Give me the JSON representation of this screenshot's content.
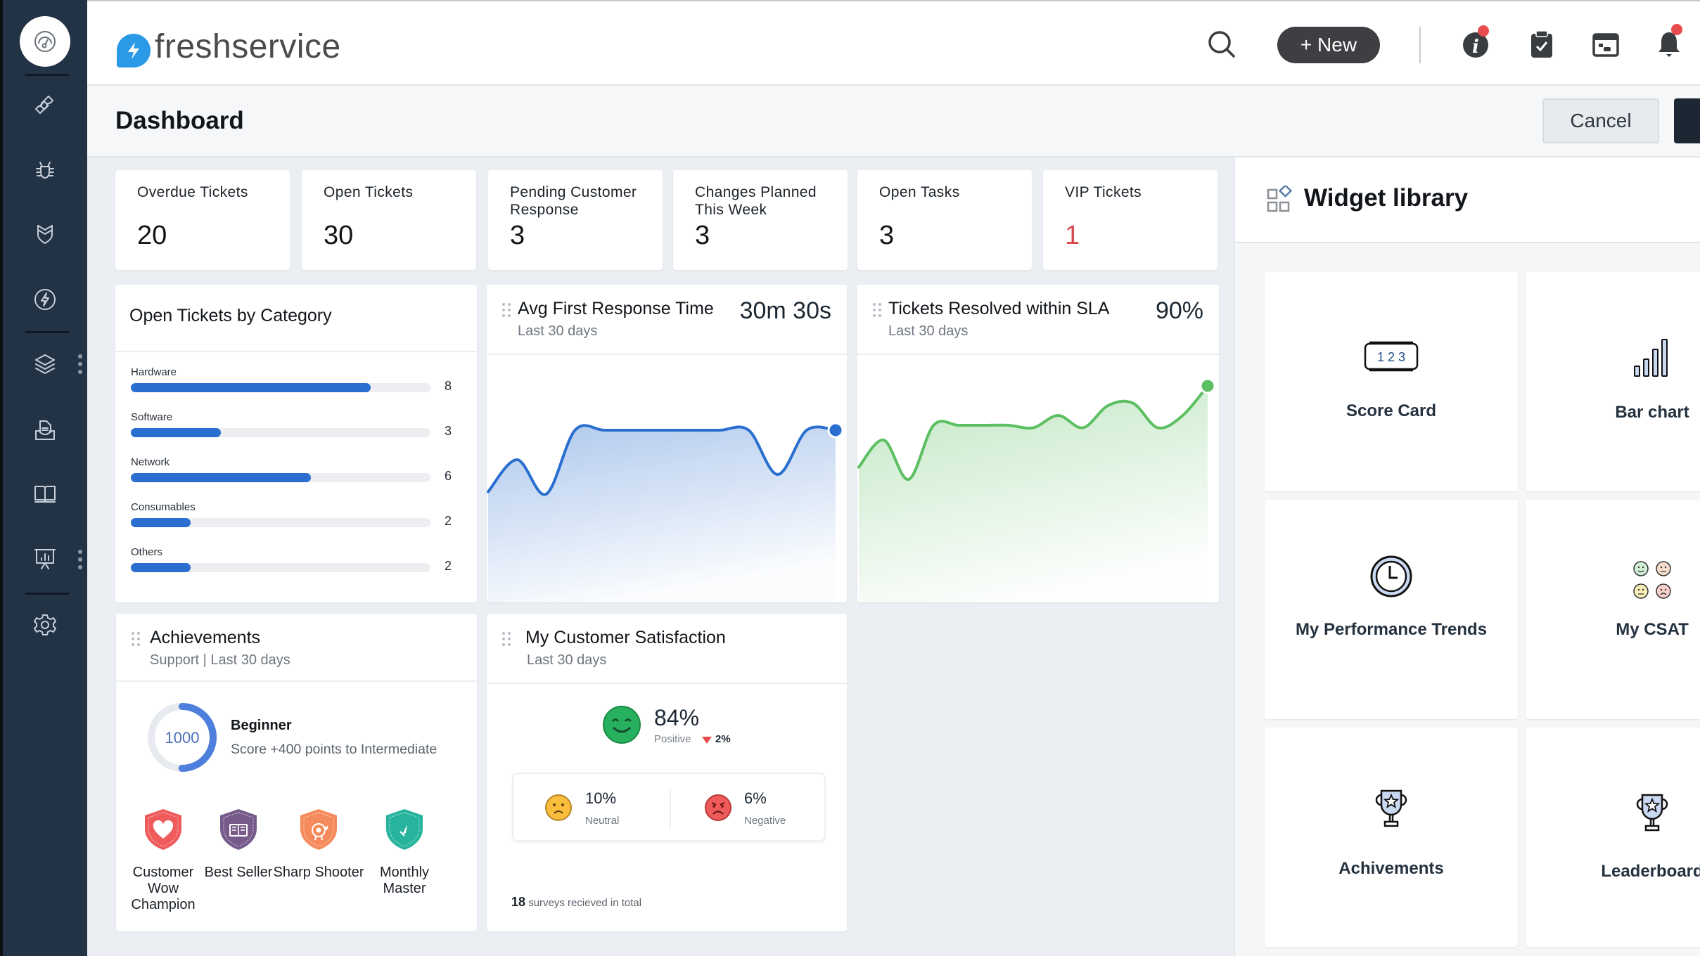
{
  "app": {
    "brand": "freshservice",
    "colors": {
      "sidebar": "#233346",
      "accent_blue": "#2a6fcf",
      "accent_green": "#5cbf61",
      "danger": "#e84c4c"
    }
  },
  "sidebar": {
    "items": [
      {
        "icon": "dashboard-gauge-icon",
        "label": "Dashboard",
        "active": true
      },
      {
        "icon": "ticket-icon",
        "label": "Tickets"
      },
      {
        "icon": "bug-icon",
        "label": "Problems"
      },
      {
        "icon": "shield-icon",
        "label": "Changes"
      },
      {
        "icon": "lightning-icon",
        "label": "Releases"
      },
      {
        "icon": "layers-icon",
        "label": "Assets"
      },
      {
        "icon": "document-tray-icon",
        "label": "Contracts"
      },
      {
        "icon": "book-icon",
        "label": "Solutions"
      },
      {
        "icon": "presentation-chart-icon",
        "label": "Reports"
      },
      {
        "icon": "gear-icon",
        "label": "Admin"
      }
    ]
  },
  "header": {
    "new_button": "+ New",
    "icons": [
      "search-icon",
      "info-icon",
      "clipboard-check-icon",
      "calendar-icon",
      "bell-icon"
    ]
  },
  "dashbar": {
    "title": "Dashboard",
    "cancel_label": "Cancel"
  },
  "kpis": [
    {
      "label": "Overdue Tickets",
      "value": "20"
    },
    {
      "label": "Open Tickets",
      "value": "30"
    },
    {
      "label": "Pending Customer Response",
      "value": "3"
    },
    {
      "label": "Changes Planned This Week",
      "value": "3"
    },
    {
      "label": "Open Tasks",
      "value": "3"
    },
    {
      "label": "VIP Tickets",
      "value": "1",
      "color": "#d9474f"
    }
  ],
  "category_widget": {
    "title": "Open Tickets by Category",
    "max": 10
  },
  "response_widget": {
    "title": "Avg First Response Time",
    "subtitle": "Last 30 days",
    "metric": "30m 30s"
  },
  "sla_widget": {
    "title": "Tickets Resolved within SLA",
    "subtitle": "Last 30 days",
    "metric": "90%"
  },
  "achievements": {
    "title": "Achievements",
    "subtitle": "Support | Last 30 days",
    "points": "1000",
    "progress": 0.5,
    "level": "Beginner",
    "next_level_text": "Score +400 points to Intermediate",
    "badges": [
      {
        "label": "Customer Wow Champion",
        "color": "#ef5b5b",
        "icon": "heart-badge-icon"
      },
      {
        "label": "Best Seller",
        "color": "#765b8a",
        "icon": "book-badge-icon"
      },
      {
        "label": "Sharp Shooter",
        "color": "#f58a5c",
        "icon": "target-badge-icon"
      },
      {
        "label": "Monthly Master",
        "color": "#27b49c",
        "icon": "rocket-badge-icon"
      }
    ]
  },
  "csat": {
    "title": "My Customer Satisfaction",
    "subtitle": "Last 30 days",
    "positive_pct": "84%",
    "positive_label": "Positive",
    "positive_change": "2%",
    "neutral_pct": "10%",
    "neutral_label": "Neutral",
    "negative_pct": "6%",
    "negative_label": "Negative",
    "surveys_count": "18",
    "surveys_text": "surveys recieved in total"
  },
  "library": {
    "title": "Widget library",
    "tiles": [
      {
        "label": "Score Card",
        "icon": "score-card-icon"
      },
      {
        "label": "Bar chart",
        "icon": "bar-chart-icon"
      },
      {
        "label": "My Performance Trends",
        "icon": "clock-icon"
      },
      {
        "label": "My CSAT",
        "icon": "csat-faces-icon"
      },
      {
        "label": "Achivements",
        "icon": "trophy-icon"
      },
      {
        "label": "Leaderboard",
        "icon": "trophy-icon"
      }
    ]
  },
  "chart_data": [
    {
      "type": "bar",
      "title": "Open Tickets by Category",
      "orientation": "horizontal",
      "categories": [
        "Hardware",
        "Software",
        "Network",
        "Consumables",
        "Others"
      ],
      "values": [
        8,
        3,
        6,
        2,
        2
      ],
      "xlim": [
        0,
        10
      ]
    },
    {
      "type": "area",
      "title": "Avg First Response Time",
      "subtitle": "Last 30 days",
      "summary": "30m 30s",
      "color": "#2a6fcf",
      "x": [
        0,
        1,
        2,
        3,
        4,
        5,
        6,
        7,
        8,
        9,
        10,
        11,
        12
      ],
      "values": [
        45,
        58,
        44,
        70,
        70,
        70,
        70,
        70,
        70,
        70,
        52,
        70,
        70
      ],
      "ylim": [
        0,
        100
      ]
    },
    {
      "type": "area",
      "title": "Tickets Resolved within SLA",
      "subtitle": "Last 30 days",
      "summary": "90%",
      "color": "#5cbf61",
      "x": [
        0,
        1,
        2,
        3,
        4,
        5,
        6,
        7,
        8,
        9,
        10,
        11,
        12,
        13,
        14
      ],
      "values": [
        55,
        66,
        50,
        72,
        72,
        72,
        72,
        71,
        76,
        71,
        80,
        81,
        71,
        76,
        88
      ],
      "ylim": [
        0,
        100
      ]
    }
  ]
}
